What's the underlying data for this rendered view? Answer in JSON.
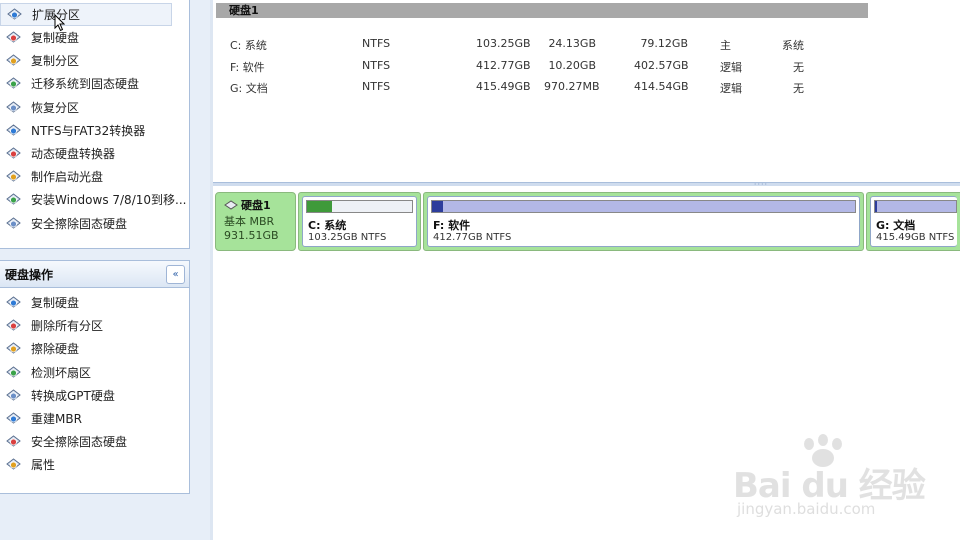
{
  "sidebar": {
    "panel1_items": [
      {
        "label": "扩展分区",
        "icon": "extend-partition-icon",
        "selected": true
      },
      {
        "label": "复制硬盘",
        "icon": "copy-disk-icon"
      },
      {
        "label": "复制分区",
        "icon": "copy-partition-icon"
      },
      {
        "label": "迁移系统到固态硬盘",
        "icon": "migrate-os-icon"
      },
      {
        "label": "恢复分区",
        "icon": "recover-partition-icon"
      },
      {
        "label": "NTFS与FAT32转换器",
        "icon": "ntfs-fat32-converter-icon"
      },
      {
        "label": "动态硬盘转换器",
        "icon": "dynamic-disk-converter-icon"
      },
      {
        "label": "制作启动光盘",
        "icon": "bootable-media-icon"
      },
      {
        "label": "安装Windows 7/8/10到移...",
        "icon": "windows-to-go-icon"
      },
      {
        "label": "安全擦除固态硬盘",
        "icon": "ssd-secure-erase-icon"
      }
    ],
    "disk_ops": {
      "title": "硬盘操作",
      "collapse_glyph": "«",
      "items": [
        {
          "label": "复制硬盘",
          "icon": "copy-disk-icon"
        },
        {
          "label": "删除所有分区",
          "icon": "delete-all-partitions-icon"
        },
        {
          "label": "擦除硬盘",
          "icon": "wipe-disk-icon"
        },
        {
          "label": "检测坏扇区",
          "icon": "bad-sector-check-icon"
        },
        {
          "label": "转换成GPT硬盘",
          "icon": "convert-gpt-icon"
        },
        {
          "label": "重建MBR",
          "icon": "rebuild-mbr-icon"
        },
        {
          "label": "安全擦除固态硬盘",
          "icon": "ssd-secure-erase-icon"
        },
        {
          "label": "属性",
          "icon": "properties-icon"
        }
      ]
    }
  },
  "partition_list": {
    "disk_title": "硬盘1",
    "rows": [
      {
        "name": "C: 系统",
        "fs": "NTFS",
        "capacity": "103.25GB",
        "used": "24.13GB",
        "free": "79.12GB",
        "type": "主",
        "status": "系统"
      },
      {
        "name": "F: 软件",
        "fs": "NTFS",
        "capacity": "412.77GB",
        "used": "10.20GB",
        "free": "402.57GB",
        "type": "逻辑",
        "status": "无"
      },
      {
        "name": "G: 文档",
        "fs": "NTFS",
        "capacity": "415.49GB",
        "used": "970.27MB",
        "free": "414.54GB",
        "type": "逻辑",
        "status": "无"
      }
    ]
  },
  "disk_map": {
    "disk_name": "硬盘1",
    "disk_type": "基本 MBR",
    "disk_size": "931.51GB",
    "partitions": [
      {
        "name": "C: 系统",
        "info": "103.25GB NTFS",
        "used_fraction": 0.234,
        "fill_color": "#3f9a3a"
      },
      {
        "name": "F: 软件",
        "info": "412.77GB NTFS",
        "used_fraction": 0.025,
        "fill_color": "#2d3d9c"
      },
      {
        "name": "G: 文档",
        "info": "415.49GB NTFS",
        "used_fraction": 0.002,
        "fill_color": "#2d3d9c"
      }
    ]
  },
  "watermark": {
    "logo": "Bai du 经验",
    "url": "jingyan.baidu.com"
  }
}
